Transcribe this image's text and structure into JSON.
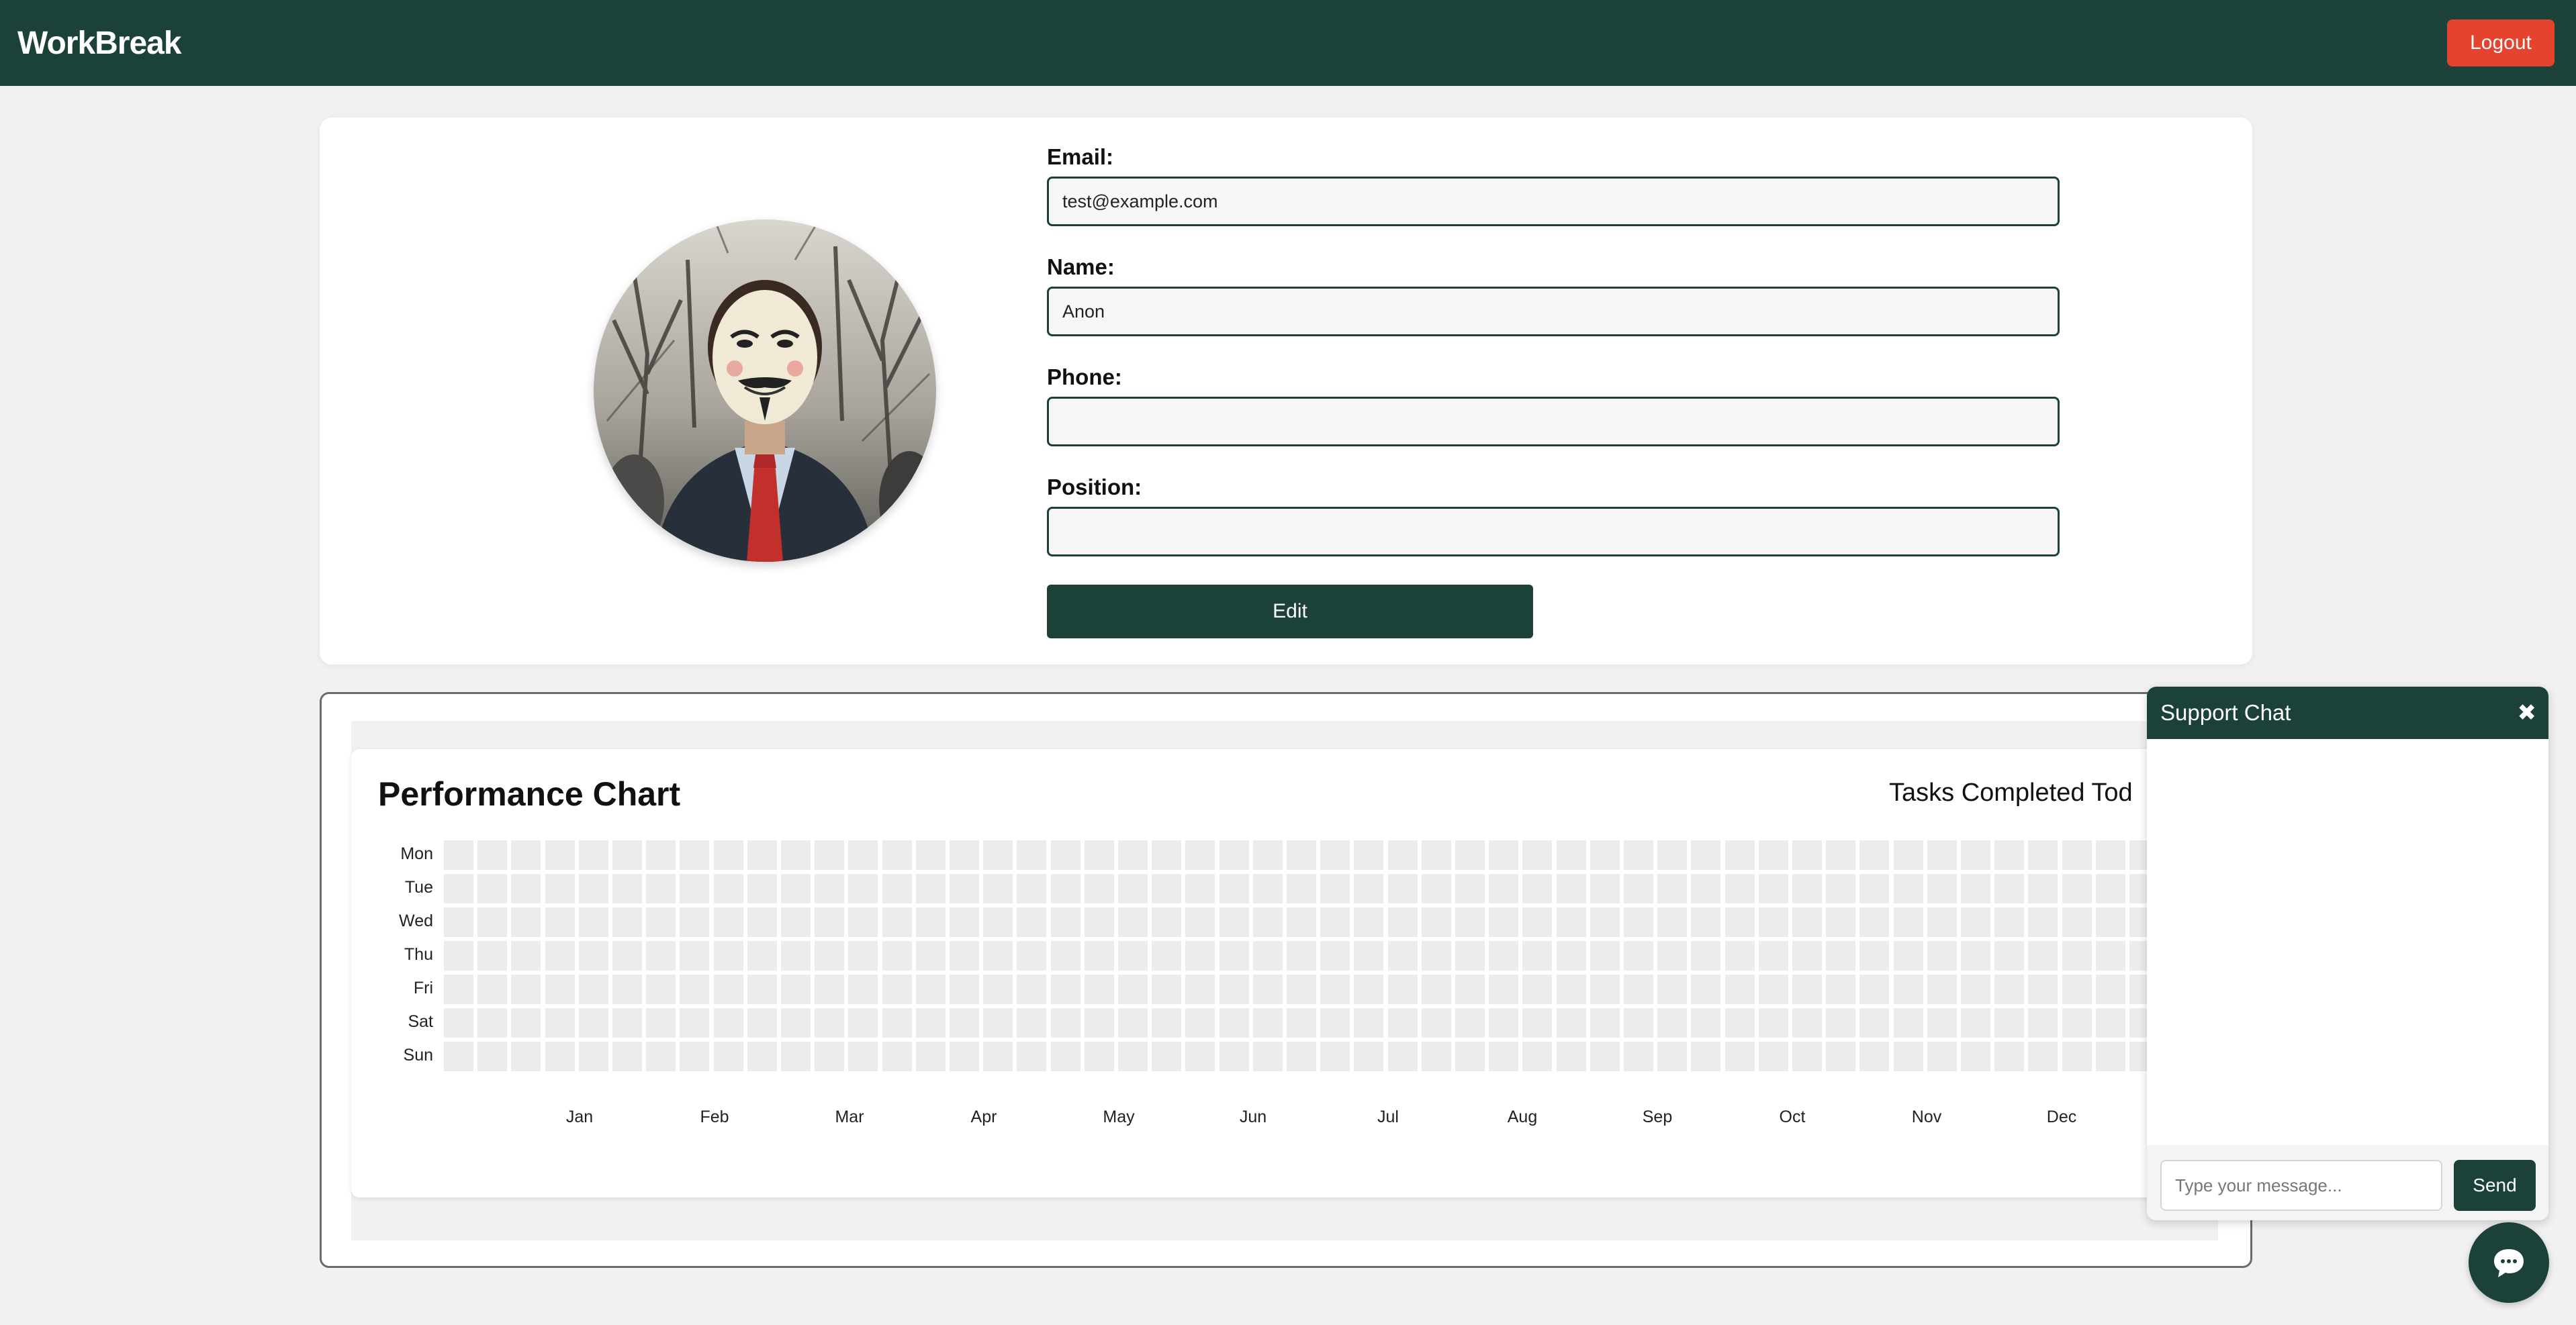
{
  "header": {
    "brand": "WorkBreak",
    "logout_label": "Logout"
  },
  "profile": {
    "fields": [
      {
        "label": "Email:",
        "value": "test@example.com",
        "placeholder": ""
      },
      {
        "label": "Name:",
        "value": "Anon",
        "placeholder": ""
      },
      {
        "label": "Phone:",
        "value": "",
        "placeholder": ""
      },
      {
        "label": "Position:",
        "value": "",
        "placeholder": ""
      }
    ],
    "edit_label": "Edit"
  },
  "performance": {
    "title": "Performance Chart",
    "side_label": "Tasks Completed Tod",
    "days": [
      "Mon",
      "Tue",
      "Wed",
      "Thu",
      "Fri",
      "Sat",
      "Sun"
    ],
    "months": [
      "Jan",
      "Feb",
      "Mar",
      "Apr",
      "May",
      "Jun",
      "Jul",
      "Aug",
      "Sep",
      "Oct",
      "Nov",
      "Dec"
    ]
  },
  "chart_data": {
    "type": "heatmap",
    "title": "Performance Chart",
    "rows": [
      "Mon",
      "Tue",
      "Wed",
      "Thu",
      "Fri",
      "Sat",
      "Sun"
    ],
    "x_labels": [
      "Jan",
      "Feb",
      "Mar",
      "Apr",
      "May",
      "Jun",
      "Jul",
      "Aug",
      "Sep",
      "Oct",
      "Nov",
      "Dec"
    ],
    "values": "all cells empty (0)"
  },
  "chat": {
    "title": "Support Chat",
    "close_icon": "close-icon",
    "input_placeholder": "Type your message...",
    "send_label": "Send",
    "fab_icon": "chat-bubble-icon"
  },
  "colors": {
    "primary": "#1b4139",
    "logout": "#e4432d",
    "background": "#f1f1f1",
    "empty_cell": "#ececec"
  }
}
